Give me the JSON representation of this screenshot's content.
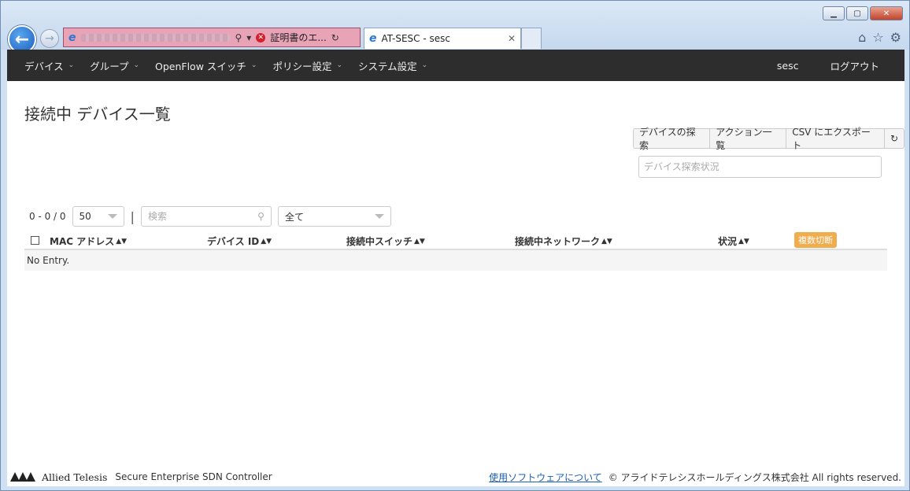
{
  "browser": {
    "cert_error": "証明書のエ...",
    "tab_title": "AT-SESC - sesc"
  },
  "navbar": {
    "items": [
      {
        "label": "デバイス"
      },
      {
        "label": "グループ"
      },
      {
        "label": "OpenFlow スイッチ"
      },
      {
        "label": "ポリシー設定"
      },
      {
        "label": "システム設定"
      }
    ],
    "user": "sesc",
    "logout": "ログアウト"
  },
  "page": {
    "title": "接続中 デバイス一覧"
  },
  "actions": {
    "discover": "デバイスの探索",
    "action_list": "アクション一覧",
    "csv_export": "CSV にエクスポート",
    "status_placeholder": "デバイス探索状況"
  },
  "filters": {
    "count": "0 - 0 / 0",
    "page_size": "50",
    "search_placeholder": "検索",
    "scope": "全て"
  },
  "table": {
    "columns": [
      "MAC アドレス",
      "デバイス ID",
      "接続中スイッチ",
      "接続中ネットワーク",
      "状況"
    ],
    "bulk_disconnect": "複数切断",
    "empty": "No Entry."
  },
  "footer": {
    "brand": "Allied Telesis",
    "product": "Secure Enterprise SDN Controller",
    "software_link": "使用ソフトウェアについて",
    "copyright": "© アライドテレシスホールディングス株式会社 All rights reserved."
  },
  "colors": {
    "navbar_bg": "#2d2d2d",
    "badge": "#f0ad4e",
    "link": "#1a5fb4"
  }
}
